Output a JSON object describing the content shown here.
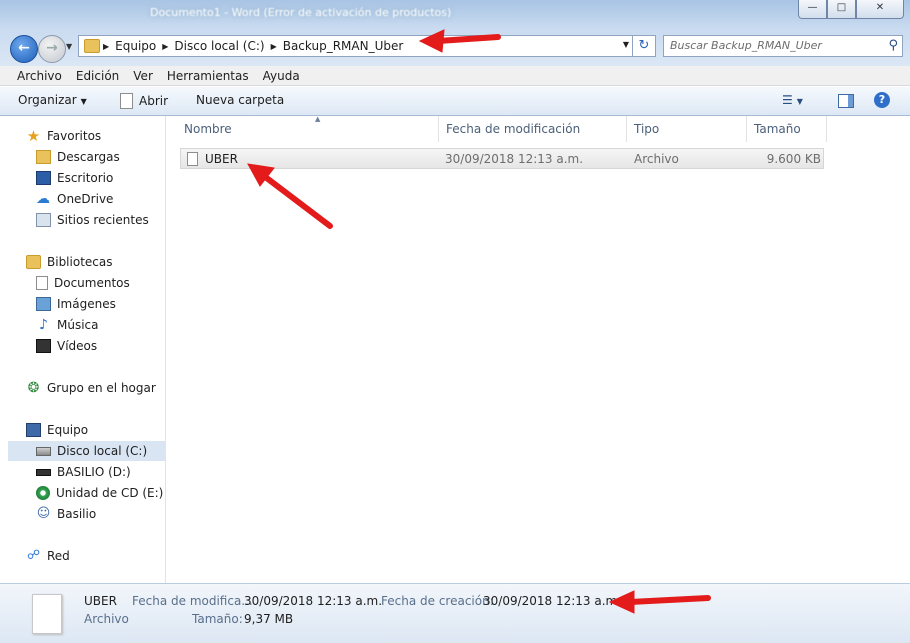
{
  "window": {
    "title": "Documento1 - Word (Error de activación de productos)"
  },
  "address": {
    "crumbs": [
      "Equipo",
      "Disco local (C:)",
      "Backup_RMAN_Uber"
    ],
    "search_placeholder": "Buscar Backup_RMAN_Uber"
  },
  "menu": [
    "Archivo",
    "Edición",
    "Ver",
    "Herramientas",
    "Ayuda"
  ],
  "toolbar": {
    "organize": "Organizar",
    "open": "Abrir",
    "new_folder": "Nueva carpeta"
  },
  "sidebar": {
    "favorites": {
      "header": "Favoritos",
      "items": [
        "Descargas",
        "Escritorio",
        "OneDrive",
        "Sitios recientes"
      ]
    },
    "libraries": {
      "header": "Bibliotecas",
      "items": [
        "Documentos",
        "Imágenes",
        "Música",
        "Vídeos"
      ]
    },
    "homegroup": "Grupo en el hogar",
    "computer": {
      "header": "Equipo",
      "items": [
        "Disco local (C:)",
        "BASILIO (D:)",
        "Unidad de CD (E:) M",
        "Basilio"
      ],
      "selected_index": 0
    },
    "network": "Red"
  },
  "columns": [
    "Nombre",
    "Fecha de modificación",
    "Tipo",
    "Tamaño"
  ],
  "files": [
    {
      "name": "UBER",
      "modified": "30/09/2018 12:13 a.m.",
      "type": "Archivo",
      "size": "9.600 KB"
    }
  ],
  "details": {
    "name": "UBER",
    "type": "Archivo",
    "modified_label": "Fecha de modifica...",
    "modified_value": "30/09/2018 12:13 a.m.",
    "created_label": "Fecha de creación:",
    "created_value": "30/09/2018 12:13 a.m.",
    "size_label": "Tamaño:",
    "size_value": "9,37 MB"
  },
  "colors": {
    "annotation_arrow": "#e31b1b",
    "selection": "#d9e5f3",
    "chrome_blue": "#c8daf0"
  }
}
